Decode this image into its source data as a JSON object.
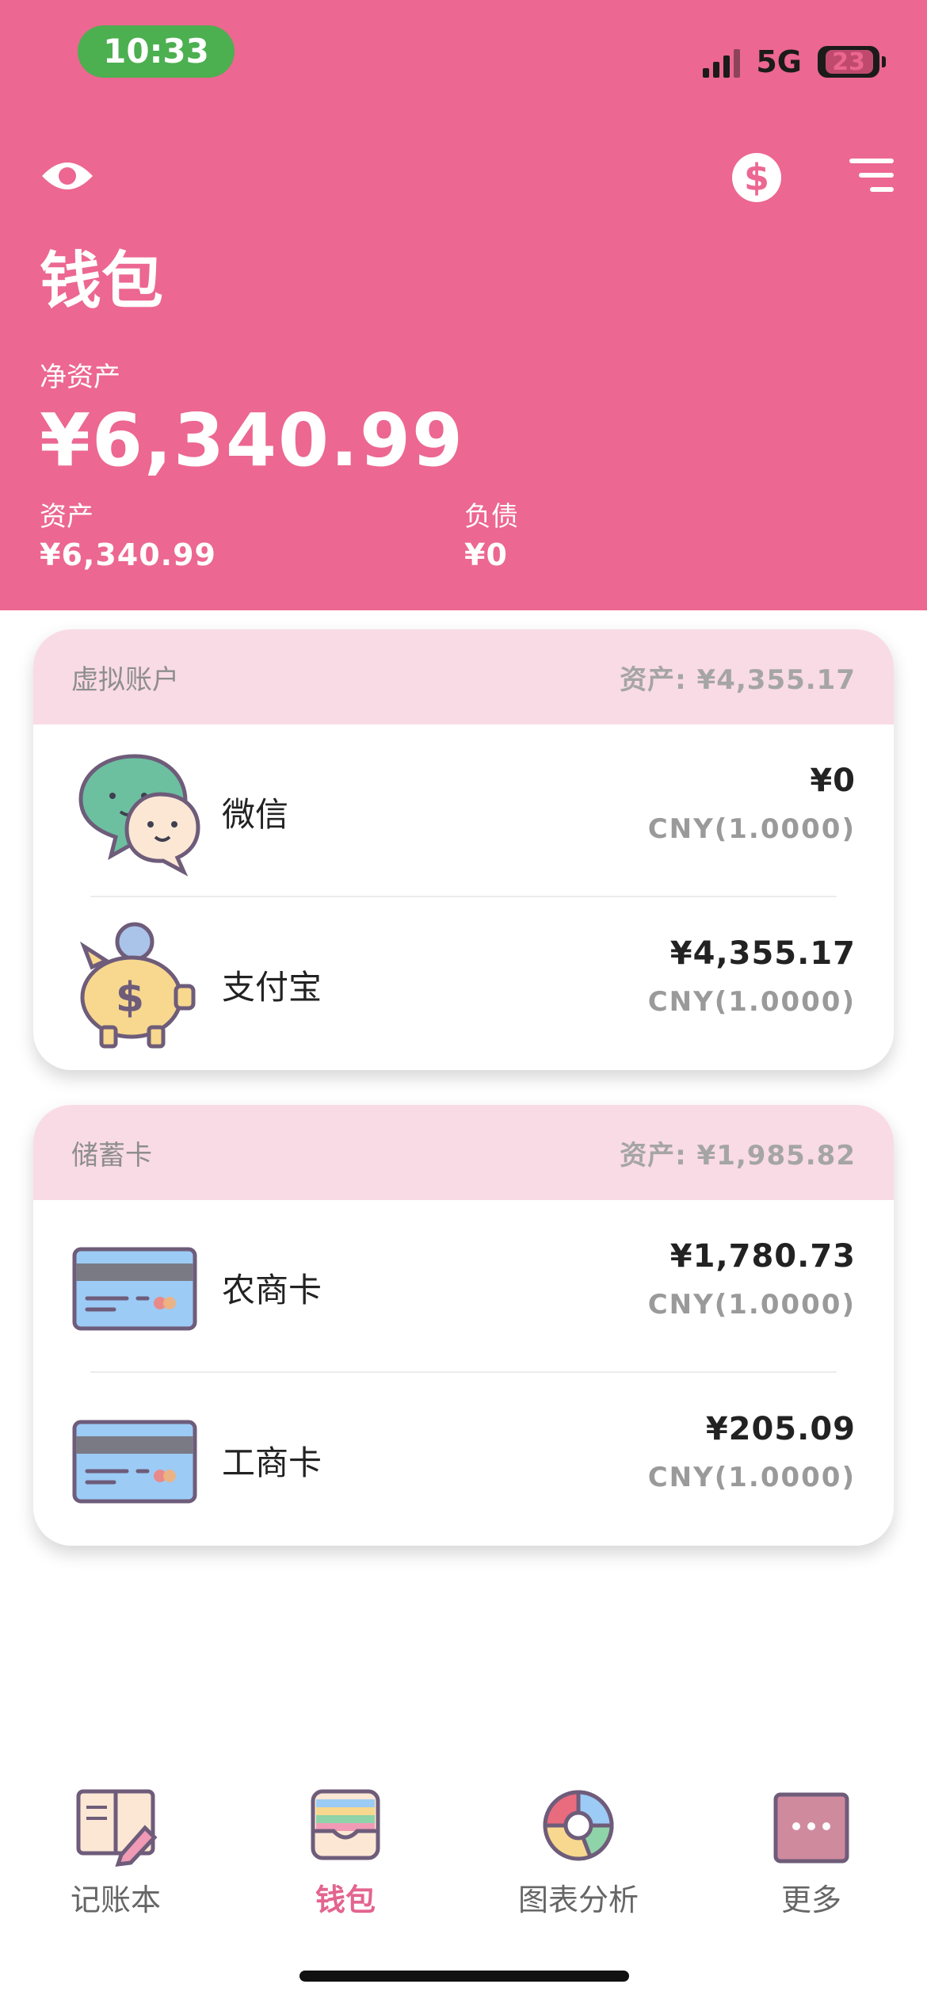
{
  "status_bar": {
    "time": "10:33",
    "network": "5G",
    "battery": "23"
  },
  "header": {
    "title": "钱包",
    "net_assets_label": "净资产",
    "net_assets_value": "¥6,340.99",
    "assets_label": "资产",
    "assets_value": "¥6,340.99",
    "liabilities_label": "负债",
    "liabilities_value": "¥0",
    "icons": {
      "visibility": "eye-icon",
      "currency": "dollar-icon",
      "sort": "filter-icon"
    }
  },
  "groups": [
    {
      "name": "虚拟账户",
      "assets": "资产: ¥4,355.17",
      "accounts": [
        {
          "name": "微信",
          "amount": "¥0",
          "rate": "CNY(1.0000)",
          "icon": "chat-bubbles-icon"
        },
        {
          "name": "支付宝",
          "amount": "¥4,355.17",
          "rate": "CNY(1.0000)",
          "icon": "piggy-bank-icon"
        }
      ]
    },
    {
      "name": "储蓄卡",
      "assets": "资产: ¥1,985.82",
      "accounts": [
        {
          "name": "农商卡",
          "amount": "¥1,780.73",
          "rate": "CNY(1.0000)",
          "icon": "bank-card-icon"
        },
        {
          "name": "工商卡",
          "amount": "¥205.09",
          "rate": "CNY(1.0000)",
          "icon": "bank-card-icon"
        }
      ]
    }
  ],
  "tabs": [
    {
      "label": "记账本",
      "icon": "ledger-book-icon",
      "active": false
    },
    {
      "label": "钱包",
      "icon": "wallet-icon",
      "active": true
    },
    {
      "label": "图表分析",
      "icon": "pie-chart-icon",
      "active": false
    },
    {
      "label": "更多",
      "icon": "more-icon",
      "active": false
    }
  ],
  "colors": {
    "primary": "#ec6791",
    "card_header": "#f9dbe5",
    "tab_active": "#e3648f"
  }
}
